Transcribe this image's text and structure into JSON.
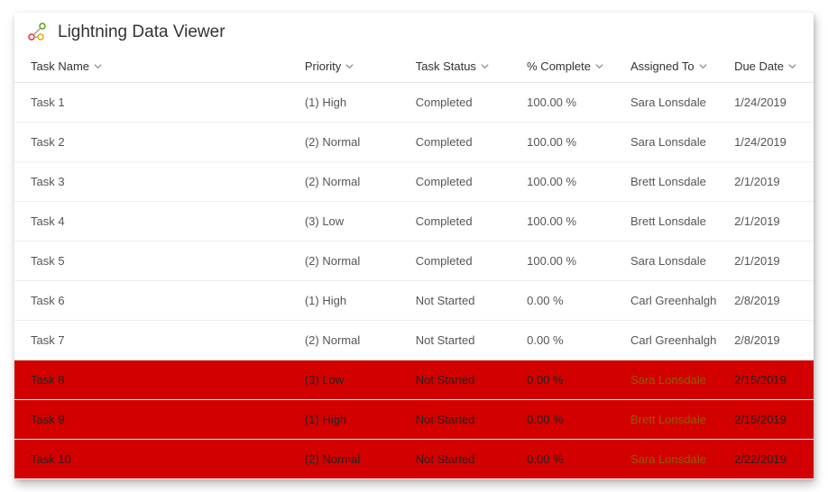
{
  "header": {
    "title": "Lightning Data Viewer"
  },
  "columns": {
    "task_name": "Task Name",
    "priority": "Priority",
    "task_status": "Task Status",
    "pct_complete": "% Complete",
    "assigned_to": "Assigned To",
    "due_date": "Due Date"
  },
  "rows": [
    {
      "task_name": "Task 1",
      "priority": "(1) High",
      "task_status": "Completed",
      "pct_complete": "100.00 %",
      "assigned_to": "Sara Lonsdale",
      "due_date": "1/24/2019",
      "highlight": false
    },
    {
      "task_name": "Task 2",
      "priority": "(2) Normal",
      "task_status": "Completed",
      "pct_complete": "100.00 %",
      "assigned_to": "Sara Lonsdale",
      "due_date": "1/24/2019",
      "highlight": false
    },
    {
      "task_name": "Task 3",
      "priority": "(2) Normal",
      "task_status": "Completed",
      "pct_complete": "100.00 %",
      "assigned_to": "Brett Lonsdale",
      "due_date": "2/1/2019",
      "highlight": false
    },
    {
      "task_name": "Task 4",
      "priority": "(3) Low",
      "task_status": "Completed",
      "pct_complete": "100.00 %",
      "assigned_to": "Brett Lonsdale",
      "due_date": "2/1/2019",
      "highlight": false
    },
    {
      "task_name": "Task 5",
      "priority": "(2) Normal",
      "task_status": "Completed",
      "pct_complete": "100.00 %",
      "assigned_to": "Sara Lonsdale",
      "due_date": "2/1/2019",
      "highlight": false
    },
    {
      "task_name": "Task 6",
      "priority": "(1) High",
      "task_status": "Not Started",
      "pct_complete": "0.00 %",
      "assigned_to": "Carl Greenhalgh",
      "due_date": "2/8/2019",
      "highlight": false
    },
    {
      "task_name": "Task 7",
      "priority": "(2) Normal",
      "task_status": "Not Started",
      "pct_complete": "0.00 %",
      "assigned_to": "Carl Greenhalgh",
      "due_date": "2/8/2019",
      "highlight": false
    },
    {
      "task_name": "Task 8",
      "priority": "(3) Low",
      "task_status": "Not Started",
      "pct_complete": "0.00 %",
      "assigned_to": "Sara Lonsdale",
      "due_date": "2/15/2019",
      "highlight": true
    },
    {
      "task_name": "Task 9",
      "priority": "(1) High",
      "task_status": "Not Started",
      "pct_complete": "0.00 %",
      "assigned_to": "Brett Lonsdale",
      "due_date": "2/15/2019",
      "highlight": true
    },
    {
      "task_name": "Task 10",
      "priority": "(2) Normal",
      "task_status": "Not Started",
      "pct_complete": "0.00 %",
      "assigned_to": "Sara Lonsdale",
      "due_date": "2/22/2019",
      "highlight": true
    }
  ],
  "colors": {
    "highlight_bg": "#d30000",
    "link_color": "#a67c00"
  }
}
